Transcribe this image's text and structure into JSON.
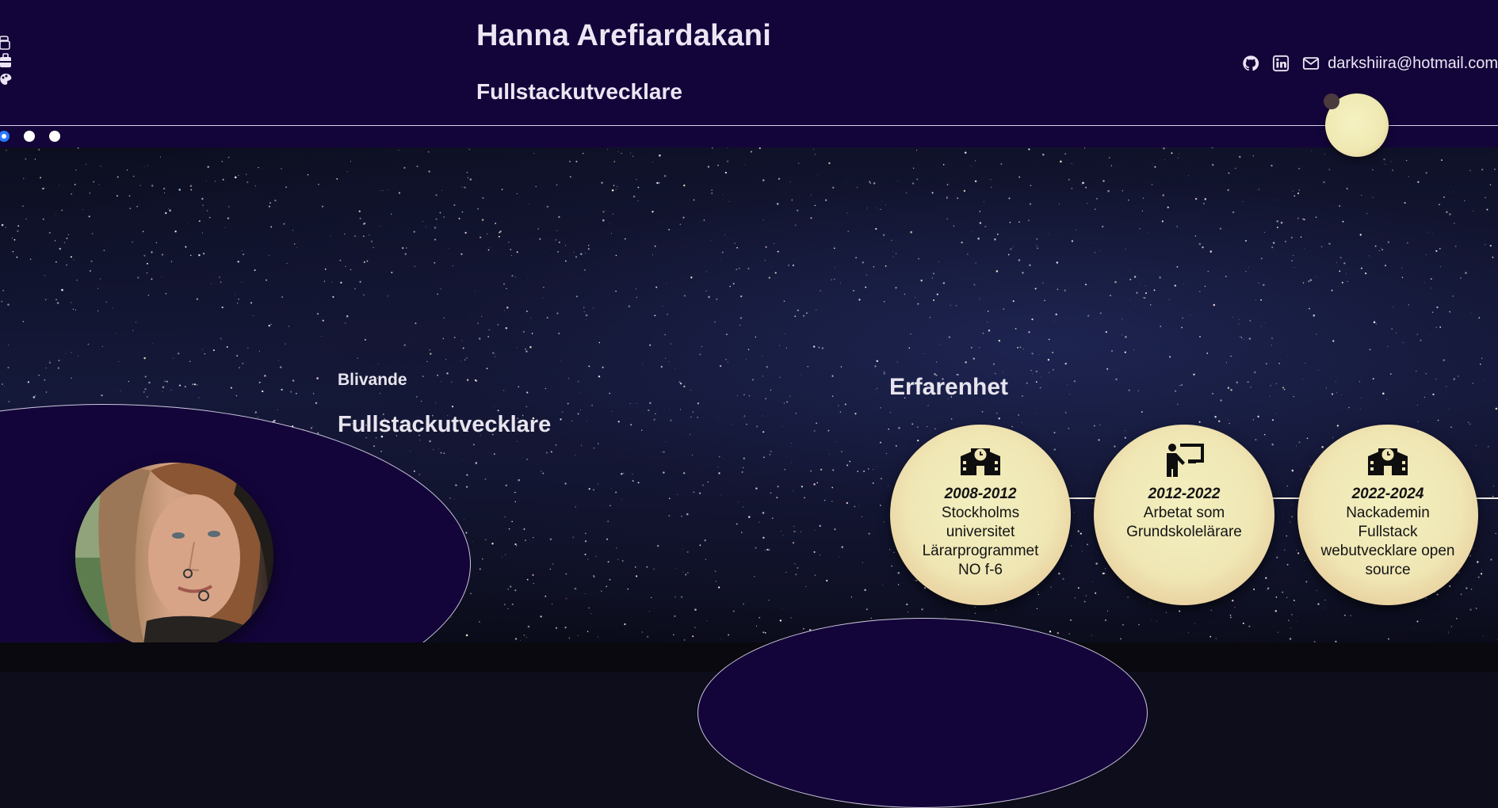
{
  "header": {
    "name": "Hanna Arefiardakani",
    "role": "Fullstackutvecklare",
    "email": "darkshiira@hotmail.com",
    "social": [
      "github-icon",
      "linkedin-icon",
      "mail-icon"
    ],
    "side_icons": [
      "toolbox-icon",
      "briefcase-icon",
      "palette-icon"
    ],
    "carousel": {
      "count": 3,
      "active": 1
    }
  },
  "hero": {
    "eyebrow": "Blivande",
    "headline": "Fullstackutvecklare"
  },
  "experience": {
    "title": "Erfarenhet",
    "items": [
      {
        "icon": "school-icon",
        "years": "2008-2012",
        "lines": [
          "Stockholms",
          "universitet",
          "Lärarprogrammet",
          "NO f-6"
        ]
      },
      {
        "icon": "teacher-icon",
        "years": "2012-2022",
        "lines": [
          "Arbetat som",
          "Grundskolelärare"
        ]
      },
      {
        "icon": "school-icon",
        "years": "2022-2024",
        "lines": [
          "Nackademin",
          "Fullstack",
          "webutvecklare open",
          "source"
        ]
      }
    ]
  },
  "colors": {
    "header_bg": "#13053a",
    "accent": "#2a79ff",
    "card": "#efe6b4",
    "text": "#e8e4ee"
  }
}
